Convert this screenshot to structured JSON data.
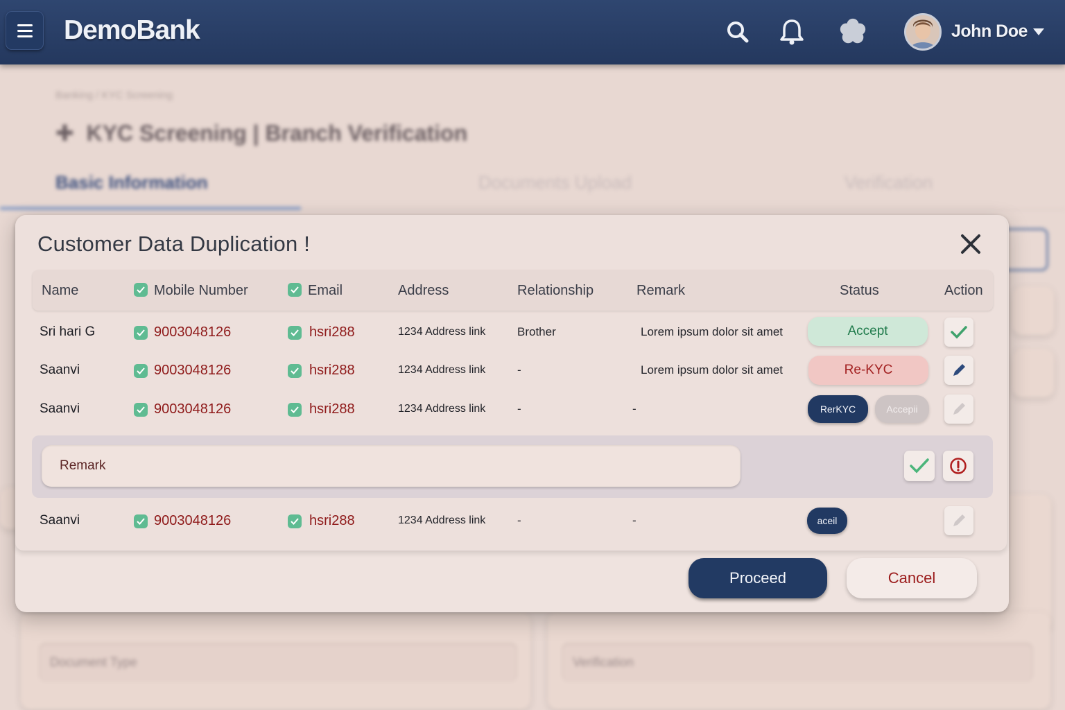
{
  "app": {
    "brand": "DemoBank",
    "user_name": "John Doe"
  },
  "background_page": {
    "breadcrumb": "Banking / KYC Screening",
    "title": "KYC Screening | Branch Verification",
    "tabs": [
      {
        "label": "Basic Information",
        "active": true
      },
      {
        "label": "Documents Upload",
        "active": false
      },
      {
        "label": "Verification",
        "active": false
      }
    ],
    "select_1": "Document Type",
    "select_2": "Verification"
  },
  "modal": {
    "title": "Customer Data Duplication !",
    "columns": {
      "name": "Name",
      "mobile": "Mobile Number",
      "email": "Email",
      "address": "Address",
      "relationship": "Relationship",
      "remark": "Remark",
      "status": "Status",
      "action": "Action"
    },
    "rows": [
      {
        "name": "Sri hari G",
        "mobile": "9003048126",
        "email": "hsri288",
        "address": "1234 Address link",
        "relationship": "Brother",
        "remark": "Lorem ipsum dolor sit amet",
        "status": "Accept"
      },
      {
        "name": "Saanvi",
        "mobile": "9003048126",
        "email": "hsri288",
        "address": "1234 Address link",
        "relationship": "-",
        "remark": "Lorem ipsum dolor sit amet",
        "status": "Re-KYC"
      },
      {
        "name": "Saanvi",
        "mobile": "9003048126",
        "email": "hsri288",
        "address": "1234 Address link",
        "relationship": "-",
        "remark": "-",
        "status_btn_1": "RerKYC",
        "status_btn_2": "Accepii"
      },
      {
        "name": "Saanvi",
        "mobile": "9003048126",
        "email": "hsri288",
        "address": "1234 Address link",
        "relationship": "-",
        "remark": "-",
        "status_btn_1": "aceil"
      }
    ],
    "remark_placeholder": "Remark",
    "proceed_label": "Proceed",
    "cancel_label": "Cancel"
  },
  "colors": {
    "navy": "#223a63",
    "accept_bg": "#cfe8d8",
    "accept_text": "#1f7a4b",
    "rekyc_bg": "#f1c7c4",
    "rekyc_text": "#a22020",
    "data_red": "#8f1a1a",
    "check_green": "#5fbb92"
  },
  "icons": [
    "menu-icon",
    "search-icon",
    "bell-icon",
    "settings-icon",
    "avatar",
    "chevron-down-icon",
    "close-icon",
    "checkbox-icon",
    "check-icon",
    "edit-icon",
    "alert-icon"
  ]
}
